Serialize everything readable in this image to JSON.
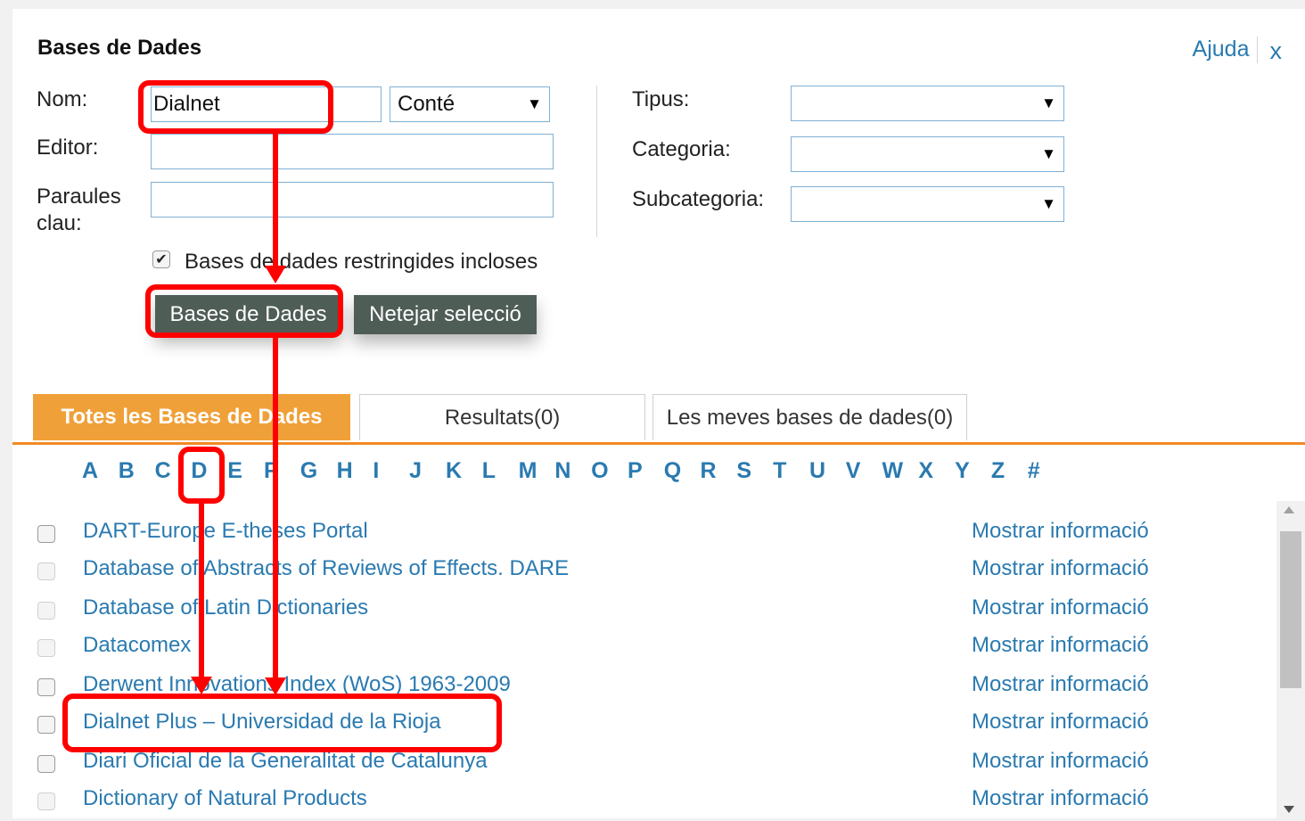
{
  "header": {
    "title": "Bases de Dades",
    "help_label": "Ajuda",
    "close_symbol": "x"
  },
  "form": {
    "name_label": "Nom:",
    "name_value": "Dialnet",
    "match_mode": "Conté",
    "editor_label": "Editor:",
    "editor_value": "",
    "keywords_label": "Paraules clau:",
    "keywords_value": "",
    "type_label": "Tipus:",
    "type_value": "",
    "category_label": "Categoria:",
    "category_value": "",
    "subcategory_label": "Subcategoria:",
    "subcategory_value": "",
    "restricted_label": "Bases de dades restringides incloses",
    "restricted_checked": true,
    "search_button": "Bases de Dades",
    "clear_button": "Netejar selecció"
  },
  "tabs": [
    {
      "label": "Totes les Bases de Dades",
      "active": true
    },
    {
      "label": "Resultats(0)",
      "active": false
    },
    {
      "label": "Les meves bases de dades(0)",
      "active": false
    }
  ],
  "alphabet": [
    "A",
    "B",
    "C",
    "D",
    "E",
    "F",
    "G",
    "H",
    "I",
    "J",
    "K",
    "L",
    "M",
    "N",
    "O",
    "P",
    "Q",
    "R",
    "S",
    "T",
    "U",
    "V",
    "W",
    "X",
    "Y",
    "Z",
    "#"
  ],
  "selected_letter": "D",
  "results": [
    {
      "name": "DART-Europe E-theses Portal",
      "info": "Mostrar informació"
    },
    {
      "name": "Database of Abstracts of Reviews of Effects. DARE",
      "info": "Mostrar informació"
    },
    {
      "name": "Database of Latin Dictionaries",
      "info": "Mostrar informació"
    },
    {
      "name": "Datacomex",
      "info": "Mostrar informació"
    },
    {
      "name": "Derwent Innovations Index (WoS) 1963-2009",
      "info": "Mostrar informació"
    },
    {
      "name": "Dialnet Plus – Universidad de la Rioja",
      "info": "Mostrar informació"
    },
    {
      "name": "Diari Oficial de la Generalitat de Catalunya",
      "info": "Mostrar informació"
    },
    {
      "name": "Dictionary of Natural Products",
      "info": "Mostrar informació"
    }
  ],
  "colors": {
    "accent": "#2a7ab0",
    "tab_active": "#f0a038",
    "button": "#4f5d57",
    "annotation": "#ff0000"
  },
  "icons": {
    "close": "close-icon",
    "caret": "caret-down-icon",
    "check": "checkmark-icon"
  }
}
